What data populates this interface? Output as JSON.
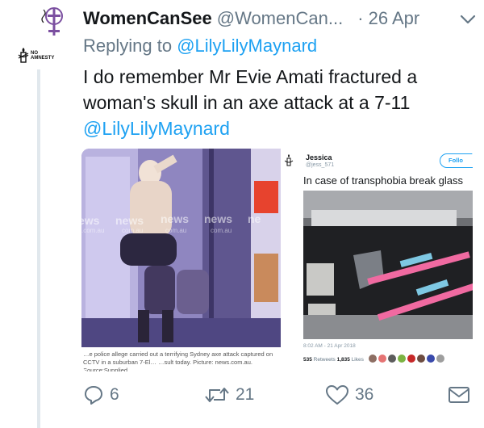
{
  "tweet": {
    "display_name": "WomenCanSee",
    "handle": "@WomenCan...",
    "date": "· 26 Apr",
    "reply_prefix": "Replying to",
    "reply_to": "@LilyLilyMaynard",
    "text": "I do remember Mr Evie Amati fractured a woman's skull in an axe attack at a 7-11",
    "text_mention": "@LilyLilyMaynard",
    "avatar_text": "NO AMNESTY"
  },
  "media": {
    "left_watermark": "news.com.au",
    "left_caption": "…e police allege carried out a terrifying Sydney axe attack captured on CCTV in a suburban 7-El… …sult today. Picture: news.com.au. Source:Supplied",
    "right": {
      "name": "Jessica",
      "handle": "@jess_571",
      "follow_label": "Follo",
      "text": "In case of transphobia break glass",
      "timestamp": "8:02 AM - 21 Apr 2018",
      "retweets_count": "535",
      "retweets_label": "Retweets",
      "likes_count": "1,835",
      "likes_label": "Likes"
    }
  },
  "actions": {
    "reply_count": "6",
    "retweet_count": "21",
    "like_count": "36"
  },
  "colors": {
    "accent": "#1da1f2",
    "muted": "#657786",
    "thread_line": "#e1e8ed"
  },
  "icons": {
    "menu": "chevron-down-icon",
    "reply": "reply-icon",
    "retweet": "retweet-icon",
    "like": "heart-icon",
    "dm": "envelope-icon"
  }
}
